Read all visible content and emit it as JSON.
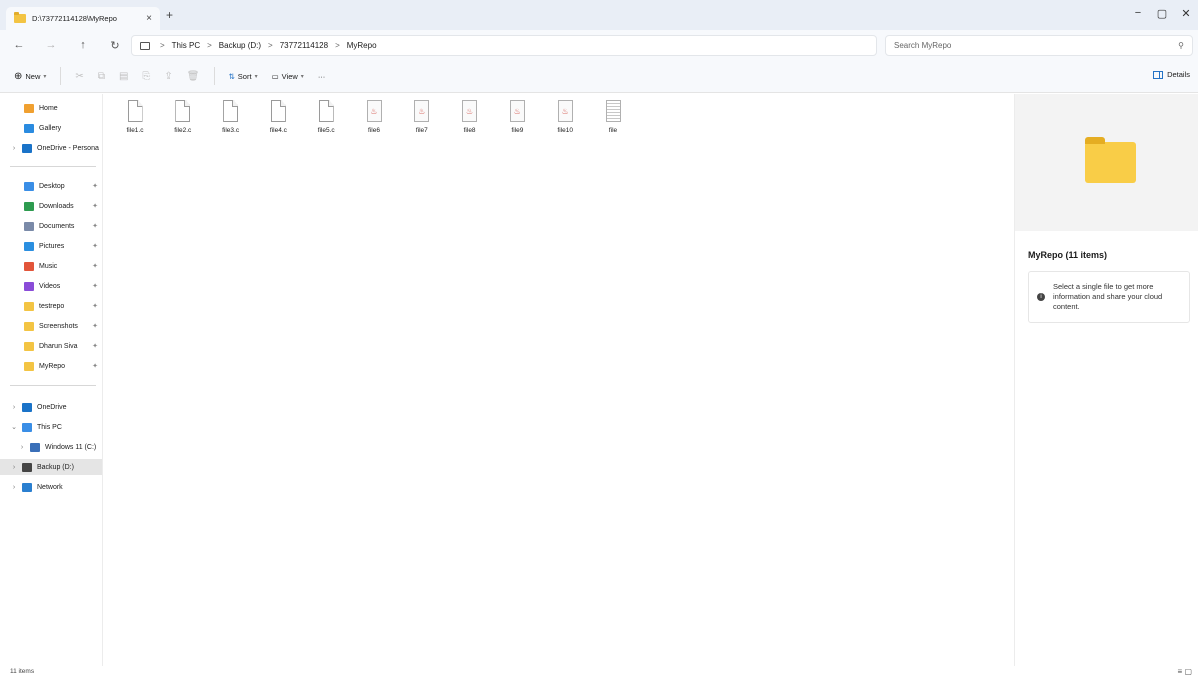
{
  "window": {
    "tab_title": "D:\\73772114128\\MyRepo",
    "tab_close": "×",
    "new_tab": "+",
    "minimize": "−",
    "maximize": "▢",
    "close": "✕"
  },
  "address": {
    "back": "←",
    "forward": "→",
    "up": "↑",
    "refresh": "↻",
    "crumbs": [
      "This PC",
      "Backup (D:)",
      "73772114128",
      "MyRepo"
    ],
    "separator": ">",
    "search_placeholder": "Search MyRepo",
    "search_icon": "⚲"
  },
  "toolbar": {
    "new_label": "New",
    "sort_label": "Sort",
    "view_label": "View",
    "more_label": "···",
    "details_label": "Details",
    "icons": [
      "cut-icon",
      "copy-icon",
      "paste-icon",
      "rename-icon",
      "share-icon",
      "delete-icon"
    ]
  },
  "sidebar": {
    "top": [
      {
        "label": "Home",
        "icon": "home-icon",
        "color": "#f0a030"
      },
      {
        "label": "Gallery",
        "icon": "gallery-icon",
        "color": "#2a8be0"
      },
      {
        "label": "OneDrive - Persona",
        "icon": "cloud-icon",
        "color": "#1a73c8"
      }
    ],
    "quick_access": [
      {
        "label": "Desktop",
        "icon": "desktop-icon",
        "color": "#3a8ee6"
      },
      {
        "label": "Downloads",
        "icon": "download-icon",
        "color": "#2d9b4f"
      },
      {
        "label": "Documents",
        "icon": "documents-icon",
        "color": "#7a8aa8"
      },
      {
        "label": "Pictures",
        "icon": "pictures-icon",
        "color": "#2b8fe0"
      },
      {
        "label": "Music",
        "icon": "music-icon",
        "color": "#e2553a"
      },
      {
        "label": "Videos",
        "icon": "videos-icon",
        "color": "#8a4cd8"
      },
      {
        "label": "testrepo",
        "icon": "folder-icon",
        "color": "#f3c443"
      },
      {
        "label": "Screenshots",
        "icon": "folder-icon",
        "color": "#f3c443"
      },
      {
        "label": "Dharun Siva",
        "icon": "folder-icon",
        "color": "#f3c443"
      },
      {
        "label": "MyRepo",
        "icon": "folder-icon",
        "color": "#f3c443"
      }
    ],
    "drives": [
      {
        "label": "OneDrive",
        "icon": "cloud-icon",
        "color": "#1a73c8",
        "chevron": ">"
      },
      {
        "label": "This PC",
        "icon": "computer-icon",
        "color": "#3a8ee6",
        "chevron": "v"
      },
      {
        "label": "Windows 11 (C:)",
        "icon": "drive-c-icon",
        "color": "#3a6fb8",
        "chevron": ">"
      },
      {
        "label": "Backup (D:)",
        "icon": "drive-d-icon",
        "color": "#444444",
        "chevron": ">"
      },
      {
        "label": "Network",
        "icon": "network-icon",
        "color": "#2a7fd0",
        "chevron": ">"
      }
    ],
    "pin_glyph": "✦"
  },
  "files": [
    {
      "name": "file1.c",
      "kind": "doc"
    },
    {
      "name": "file2.c",
      "kind": "doc"
    },
    {
      "name": "file3.c",
      "kind": "doc"
    },
    {
      "name": "file4.c",
      "kind": "doc"
    },
    {
      "name": "file5.c",
      "kind": "doc"
    },
    {
      "name": "file6",
      "kind": "java"
    },
    {
      "name": "file7",
      "kind": "java"
    },
    {
      "name": "file8",
      "kind": "java"
    },
    {
      "name": "file9",
      "kind": "java"
    },
    {
      "name": "file10",
      "kind": "java"
    },
    {
      "name": "file",
      "kind": "txt"
    }
  ],
  "details": {
    "title": "MyRepo (11 items)",
    "info": "Select a single file to get more information and share your cloud content.",
    "info_glyph": "i"
  },
  "status": {
    "count": "11 items",
    "view_icons": "≡ ▢"
  }
}
